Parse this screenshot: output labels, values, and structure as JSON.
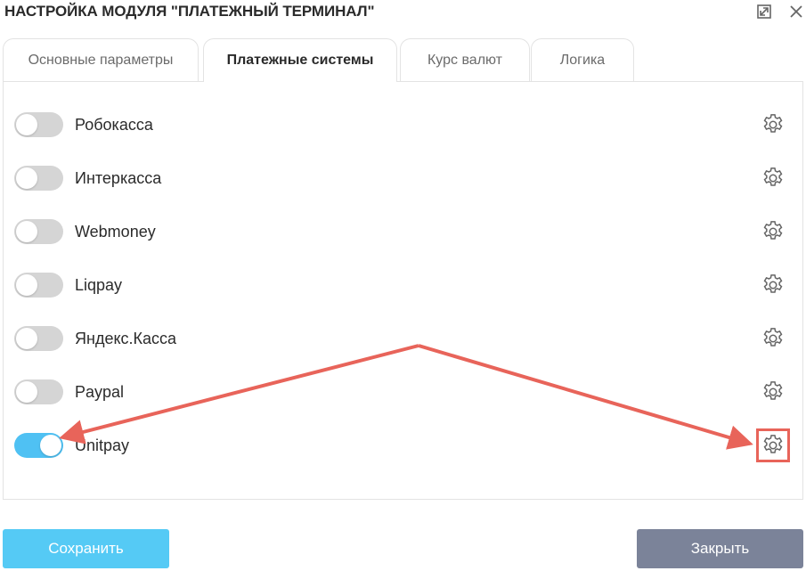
{
  "window": {
    "title": "НАСТРОЙКА МОДУЛЯ \"ПЛАТЕЖНЫЙ ТЕРМИНАЛ\"",
    "maximize_icon": "expand-icon",
    "close_icon": "close-icon"
  },
  "tabs": [
    {
      "label": "Основные параметры",
      "active": false
    },
    {
      "label": "Платежные системы",
      "active": true
    },
    {
      "label": "Курс валют",
      "active": false
    },
    {
      "label": "Логика",
      "active": false
    }
  ],
  "payment_systems": [
    {
      "label": "Робокасса",
      "enabled": false
    },
    {
      "label": "Интеркасса",
      "enabled": false
    },
    {
      "label": "Webmoney",
      "enabled": false
    },
    {
      "label": "Liqpay",
      "enabled": false
    },
    {
      "label": "Яндекс.Касса",
      "enabled": false
    },
    {
      "label": "Paypal",
      "enabled": false
    },
    {
      "label": "Unitpay",
      "enabled": true
    }
  ],
  "buttons": {
    "save": "Сохранить",
    "close": "Закрыть"
  },
  "colors": {
    "toggle_on": "#4fc1f3",
    "toggle_off": "#d5d5d5",
    "save_button": "#55caf5",
    "close_button": "#7b8399",
    "annotation": "#e8645a"
  }
}
